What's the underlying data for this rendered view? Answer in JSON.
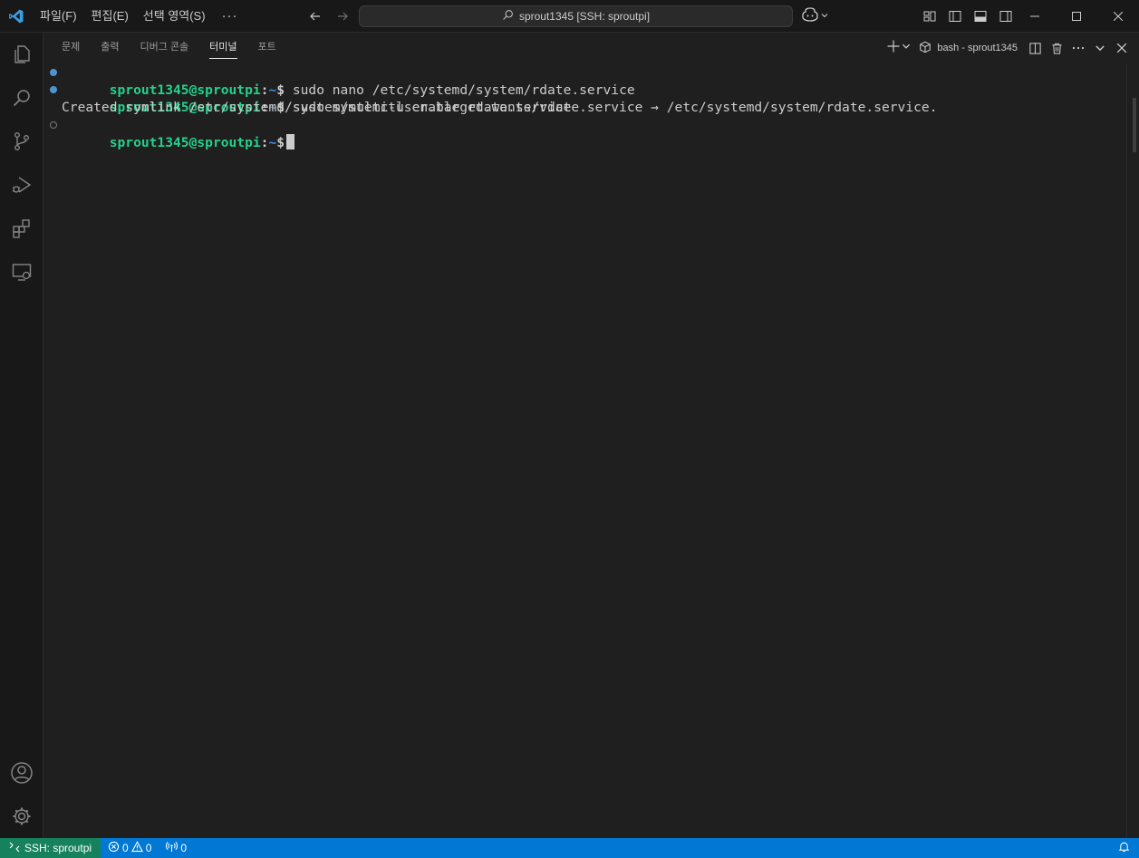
{
  "titlebar": {
    "menu": [
      "파일(F)",
      "편집(E)",
      "선택 영역(S)"
    ],
    "more": "···",
    "command_center": "sprout1345 [SSH: sproutpi]"
  },
  "activitybar": {
    "icons": [
      "explorer-icon",
      "search-icon",
      "source-control-icon",
      "run-debug-icon",
      "extensions-icon",
      "remote-explorer-icon",
      "account-icon",
      "settings-gear-icon"
    ]
  },
  "panel": {
    "tabs": [
      "문제",
      "출력",
      "디버그 콘솔",
      "터미널",
      "포트"
    ],
    "active_tab": "터미널",
    "terminal_name": "bash - sprout1345"
  },
  "terminal": {
    "lines": [
      {
        "user": "sprout1345@sproutpi",
        "path": "~",
        "command": " sudo nano /etc/systemd/system/rdate.service",
        "status": "done"
      },
      {
        "user": "sprout1345@sproutpi",
        "path": "~",
        "command": " sudo systemctl enable rdate.service",
        "status": "done"
      }
    ],
    "output": "Created symlink /etc/systemd/system/multi-user.target.wants/rdate.service → /etc/systemd/system/rdate.service.",
    "current_prompt": {
      "user": "sprout1345@sproutpi",
      "path": "~"
    }
  },
  "statusbar": {
    "remote": "SSH: sproutpi",
    "errors": "0",
    "warnings": "0",
    "ports": "0"
  },
  "colors": {
    "accent": "#0078d4",
    "remote": "#16825d",
    "prompt_user": "#23d18b",
    "prompt_path": "#3b8eea"
  }
}
